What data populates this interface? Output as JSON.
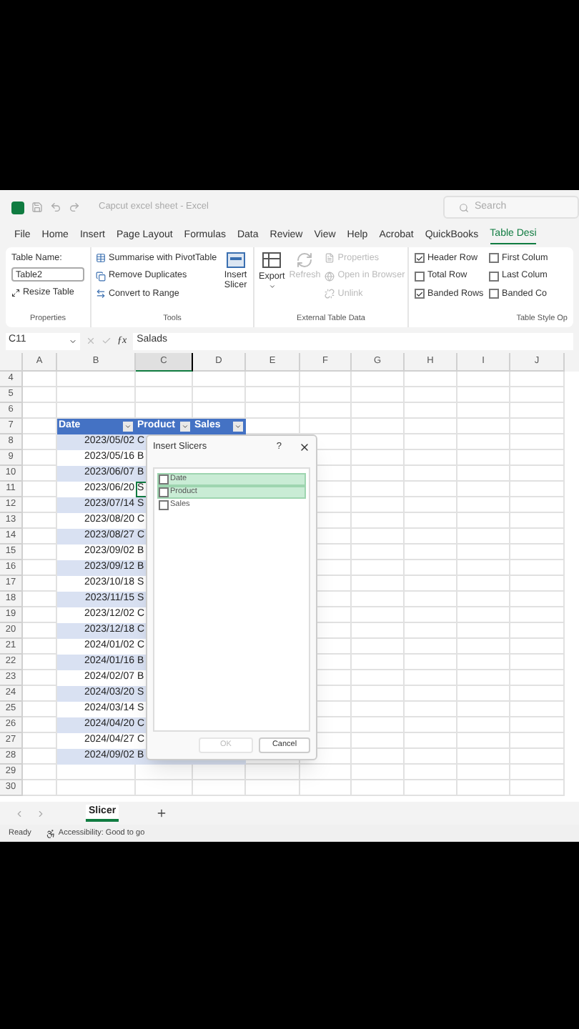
{
  "title_bar": {
    "title": "Capcut excel sheet - Excel",
    "search_placeholder": "Search"
  },
  "ribbon_tabs": [
    {
      "label": "File",
      "selected": false
    },
    {
      "label": "Home",
      "selected": false
    },
    {
      "label": "Insert",
      "selected": false
    },
    {
      "label": "Page Layout",
      "selected": false
    },
    {
      "label": "Formulas",
      "selected": false
    },
    {
      "label": "Data",
      "selected": false
    },
    {
      "label": "Review",
      "selected": false
    },
    {
      "label": "View",
      "selected": false
    },
    {
      "label": "Help",
      "selected": false
    },
    {
      "label": "Acrobat",
      "selected": false
    },
    {
      "label": "QuickBooks",
      "selected": false
    },
    {
      "label": "Table Desi",
      "selected": true
    }
  ],
  "ribbon": {
    "properties": {
      "table_name_label": "Table Name:",
      "table_name": "Table2",
      "resize": "Resize Table",
      "group_label": "Properties"
    },
    "tools": {
      "commands": [
        {
          "label": "Summarise with PivotTable"
        },
        {
          "label": "Remove Duplicates"
        },
        {
          "label": "Convert to Range"
        }
      ],
      "insert_slicer": "Insert Slicer",
      "group_label": "Tools"
    },
    "external": {
      "export": "Export",
      "refresh": {
        "label": "Refresh",
        "disabled": true
      },
      "commands": [
        {
          "label": "Properties",
          "disabled": true
        },
        {
          "label": "Open in Browser",
          "disabled": true
        },
        {
          "label": "Unlink",
          "disabled": true
        }
      ],
      "group_label": "External Table Data"
    },
    "style_options": {
      "options": [
        {
          "label": "Header Row",
          "checked": true
        },
        {
          "label": "First Colum",
          "checked": false
        },
        {
          "label": "Total Row",
          "checked": false
        },
        {
          "label": "Last Colum",
          "checked": false
        },
        {
          "label": "Banded Rows",
          "checked": true
        },
        {
          "label": "Banded Co",
          "checked": false
        }
      ],
      "group_label": "Table Style Op"
    }
  },
  "formula_bar": {
    "name_box": "C11",
    "function_label": "ƒx",
    "formula": "Salads"
  },
  "columns": [
    "A",
    "B",
    "C",
    "D",
    "E",
    "F",
    "G",
    "H",
    "I",
    "J"
  ],
  "rows_before": [
    "4",
    "5",
    "6"
  ],
  "table": {
    "header_row": "7",
    "headers": [
      "Date",
      "Product",
      "Sales"
    ],
    "rows": [
      {
        "number": "8",
        "date": "2023/05/02",
        "product": "C",
        "active": false
      },
      {
        "number": "9",
        "date": "2023/05/16",
        "product": "B",
        "active": false
      },
      {
        "number": "10",
        "date": "2023/06/07",
        "product": "B",
        "active": false
      },
      {
        "number": "11",
        "date": "2023/06/20",
        "product": "S",
        "active": true
      },
      {
        "number": "12",
        "date": "2023/07/14",
        "product": "S",
        "active": false
      },
      {
        "number": "13",
        "date": "2023/08/20",
        "product": "C",
        "active": false
      },
      {
        "number": "14",
        "date": "2023/08/27",
        "product": "C",
        "active": false
      },
      {
        "number": "15",
        "date": "2023/09/02",
        "product": "B",
        "active": false
      },
      {
        "number": "16",
        "date": "2023/09/12",
        "product": "B",
        "active": false
      },
      {
        "number": "17",
        "date": "2023/10/18",
        "product": "S",
        "active": false
      },
      {
        "number": "18",
        "date": "2023/11/15",
        "product": "S",
        "active": false
      },
      {
        "number": "19",
        "date": "2023/12/02",
        "product": "C",
        "active": false
      },
      {
        "number": "20",
        "date": "2023/12/18",
        "product": "C",
        "active": false
      },
      {
        "number": "21",
        "date": "2024/01/02",
        "product": "C",
        "active": false
      },
      {
        "number": "22",
        "date": "2024/01/16",
        "product": "B",
        "active": false
      },
      {
        "number": "23",
        "date": "2024/02/07",
        "product": "B",
        "active": false
      },
      {
        "number": "24",
        "date": "2024/03/20",
        "product": "S",
        "active": false
      },
      {
        "number": "25",
        "date": "2024/03/14",
        "product": "S",
        "active": false
      },
      {
        "number": "26",
        "date": "2024/04/20",
        "product": "C",
        "active": false
      },
      {
        "number": "27",
        "date": "2024/04/27",
        "product": "C",
        "active": false
      },
      {
        "number": "28",
        "date": "2024/09/02",
        "product": "B",
        "active": false
      }
    ]
  },
  "rows_after": [
    "29",
    "30"
  ],
  "dialog": {
    "title": "Insert Slicers",
    "help": "?",
    "fields": [
      {
        "label": "Date",
        "checked": false,
        "highlighted": true
      },
      {
        "label": "Product",
        "checked": false,
        "highlighted": true
      },
      {
        "label": "Sales",
        "checked": false,
        "highlighted": false
      }
    ],
    "ok": {
      "label": "OK",
      "disabled": true
    },
    "cancel": "Cancel"
  },
  "sheet_tabs": [
    {
      "label": "Slicer",
      "selected": true
    }
  ],
  "status_bar": {
    "ready": "Ready",
    "accessibility": "Accessibility: Good to go"
  }
}
